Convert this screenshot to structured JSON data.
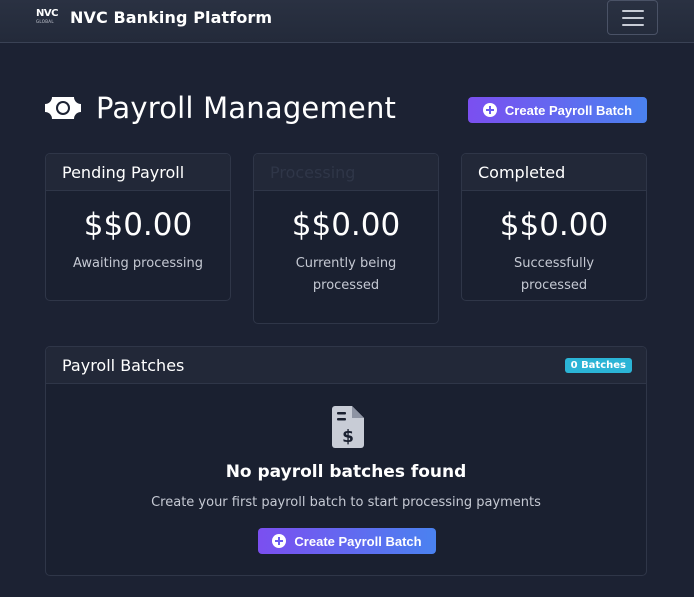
{
  "navbar": {
    "logo_text": "NVC",
    "logo_subtext": "GLOBAL",
    "brand_name": "NVC Banking Platform",
    "menu_icon": "hamburger-menu-icon"
  },
  "header": {
    "icon": "money-bill-icon",
    "title": "Payroll Management",
    "create_button_label": "Create Payroll Batch"
  },
  "stats": [
    {
      "label": "Pending Payroll",
      "value": "$$0.00",
      "caption": "Awaiting processing"
    },
    {
      "label": "Processing",
      "value": "$$0.00",
      "caption": "Currently being processed"
    },
    {
      "label": "Completed",
      "value": "$$0.00",
      "caption": "Successfully processed"
    }
  ],
  "batches": {
    "title": "Payroll Batches",
    "badge": "0 Batches",
    "empty_icon": "invoice-dollar-icon",
    "empty_title": "No payroll batches found",
    "empty_subtitle": "Create your first payroll batch to start processing payments",
    "create_button_label": "Create Payroll Batch"
  },
  "colors": {
    "background": "#1c2233",
    "accent_gradient_start": "#7b4ff0",
    "accent_gradient_end": "#4a82f0",
    "badge": "#2bb4d6"
  }
}
